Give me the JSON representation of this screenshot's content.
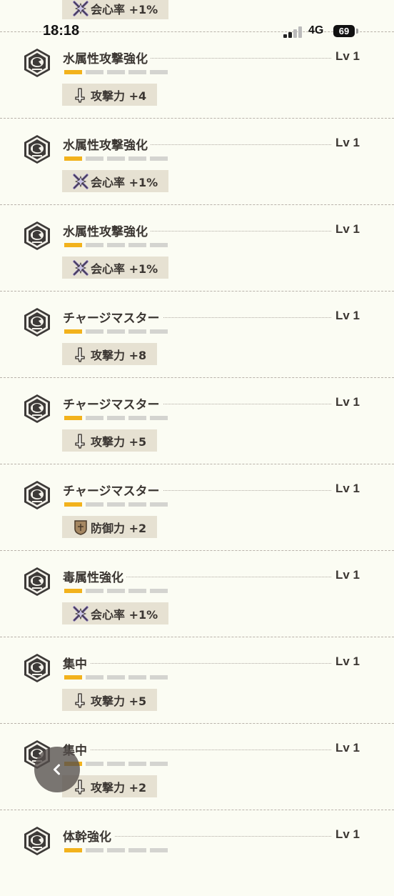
{
  "status_bar": {
    "time": "18:18",
    "network": "4G",
    "battery": "69"
  },
  "level_label": "Lv 1",
  "rows": [
    {
      "name": "",
      "level": "",
      "effect_icon": "critical-icon",
      "effect": "会心率 +1%"
    },
    {
      "name": "水属性攻撃強化",
      "level": "Lv 1",
      "effect_icon": "attack-icon",
      "effect": "攻撃力 +4"
    },
    {
      "name": "水属性攻撃強化",
      "level": "Lv 1",
      "effect_icon": "critical-icon",
      "effect": "会心率 +1%"
    },
    {
      "name": "水属性攻撃強化",
      "level": "Lv 1",
      "effect_icon": "critical-icon",
      "effect": "会心率 +1%"
    },
    {
      "name": "チャージマスター",
      "level": "Lv 1",
      "effect_icon": "attack-icon",
      "effect": "攻撃力 +8"
    },
    {
      "name": "チャージマスター",
      "level": "Lv 1",
      "effect_icon": "attack-icon",
      "effect": "攻撃力 +5"
    },
    {
      "name": "チャージマスター",
      "level": "Lv 1",
      "effect_icon": "defense-icon",
      "effect": "防御力 +2"
    },
    {
      "name": "毒属性強化",
      "level": "Lv 1",
      "effect_icon": "critical-icon",
      "effect": "会心率 +1%"
    },
    {
      "name": "集中",
      "level": "Lv 1",
      "effect_icon": "attack-icon",
      "effect": "攻撃力 +5"
    },
    {
      "name": "集中",
      "level": "Lv 1",
      "effect_icon": "attack-icon",
      "effect": "攻撃力 +2"
    },
    {
      "name": "体幹強化",
      "level": "Lv 1",
      "effect_icon": "",
      "effect": ""
    }
  ],
  "level_bar": {
    "filled": 1,
    "total": 5
  },
  "colors": {
    "background": "#fbfcf3",
    "bar_filled": "#f2b21c",
    "bar_empty": "#d4d4d0",
    "effect_chip": "#e6e1d2",
    "text": "#3b3632"
  }
}
